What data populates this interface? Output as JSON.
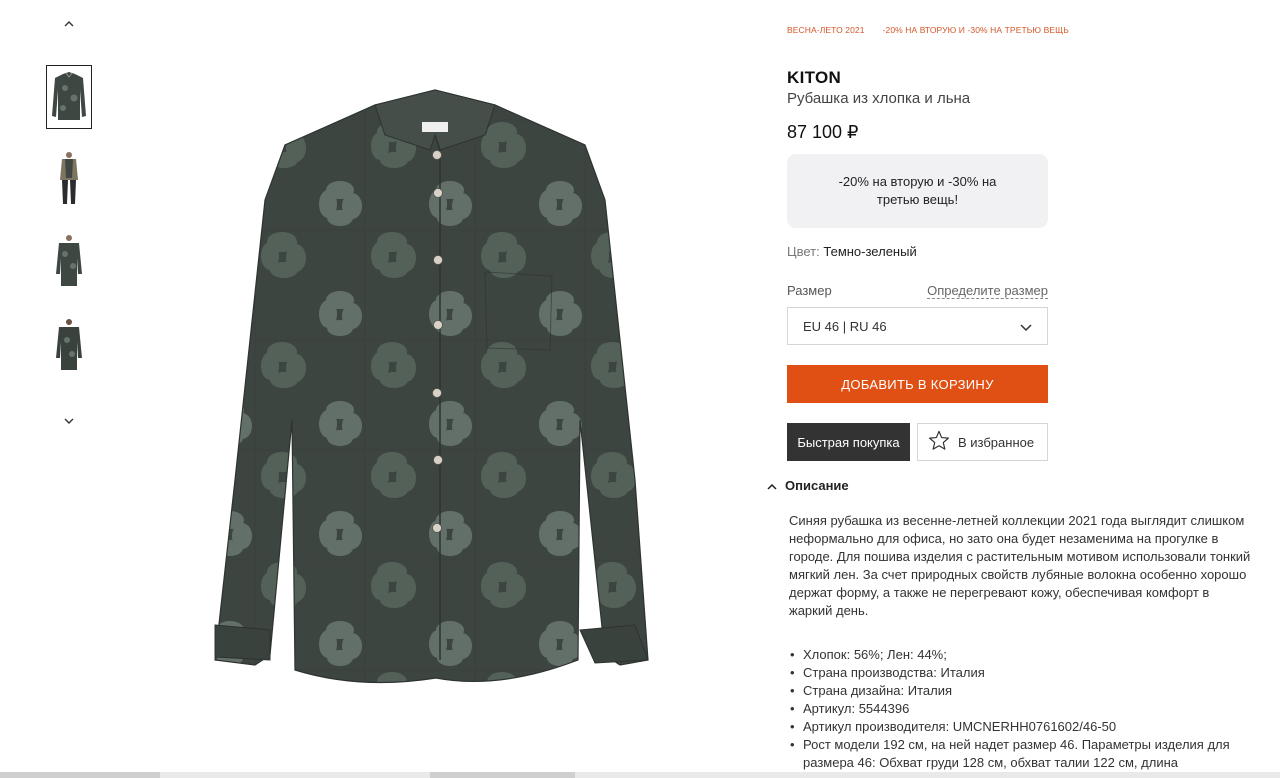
{
  "gallery": {
    "up_icon": "chevron-up-icon",
    "down_icon": "chevron-down-icon",
    "thumbnails": [
      "shirt-front",
      "model-full-body",
      "model-front",
      "model-back"
    ],
    "active_index": 0
  },
  "product": {
    "tags": [
      "ВЕСНА-ЛЕТО 2021",
      "-20% НА ВТОРУЮ И -30% НА ТРЕТЬЮ ВЕЩЬ"
    ],
    "brand": "KITON",
    "name": "Рубашка из хлопка и льна",
    "price": "87 100 ₽",
    "promo": "-20% на вторую и -30% на третью вещь!",
    "color_label": "Цвет:",
    "color_value": "Темно-зеленый",
    "size_label": "Размер",
    "size_guide": "Определите размер",
    "size_selected": "EU 46 | RU 46",
    "add_to_cart": "ДОБАВИТЬ В КОРЗИНУ",
    "quick_buy": "Быстрая покупка",
    "favorite": "В избранное",
    "description_title": "Описание",
    "description": "Синяя рубашка из весенне-летней коллекции 2021 года выглядит слишком неформально для офиса, но зато она будет незаменима на прогулке в городе. Для пошива изделия с растительным мотивом использовали тонкий мягкий лен. За счет природных свойств лубяные волокна особенно хорошо держат форму, а также не перегревают кожу, обеспечивая комфорт в жаркий день.",
    "specs": [
      "Хлопок: 56%; Лен: 44%;",
      "Страна производства: Италия",
      "Страна дизайна: Италия",
      "Артикул: 5544396",
      "Артикул производителя: UMCNERHH0761602/46-50",
      "Рост модели 192 см, на ней надет размер 46. Параметры изделия для размера 46: Обхват груди 128 см, обхват талии 122 см, длина"
    ]
  },
  "colors": {
    "accent": "#e05015",
    "tag": "#d4572a",
    "dark_button": "#333333",
    "promo_bg": "#f1f1f4",
    "shirt": "#3d4541",
    "shirt_pattern": "#6f7d74"
  }
}
